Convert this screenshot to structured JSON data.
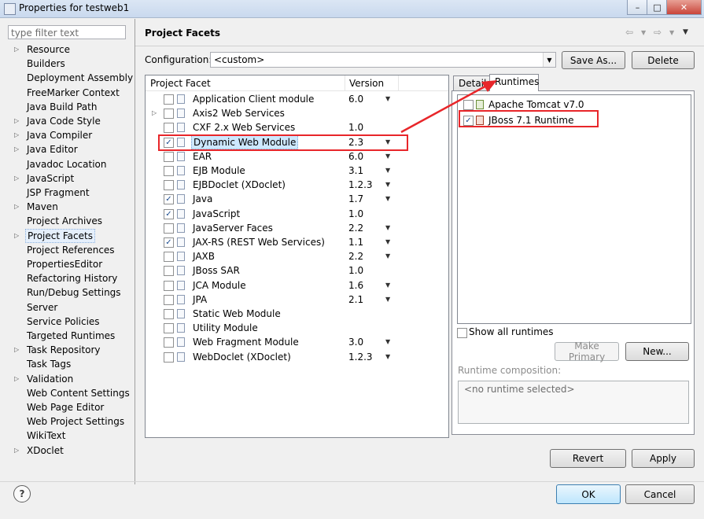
{
  "window": {
    "title": "Properties for testweb1",
    "minimize": "–",
    "maximize": "□",
    "close": "✕"
  },
  "filter": {
    "placeholder": "type filter text"
  },
  "nav": {
    "items": [
      {
        "label": "Resource",
        "expandable": true
      },
      {
        "label": "Builders",
        "expandable": false
      },
      {
        "label": "Deployment Assembly",
        "expandable": false
      },
      {
        "label": "FreeMarker Context",
        "expandable": false
      },
      {
        "label": "Java Build Path",
        "expandable": false
      },
      {
        "label": "Java Code Style",
        "expandable": true
      },
      {
        "label": "Java Compiler",
        "expandable": true
      },
      {
        "label": "Java Editor",
        "expandable": true
      },
      {
        "label": "Javadoc Location",
        "expandable": false
      },
      {
        "label": "JavaScript",
        "expandable": true
      },
      {
        "label": "JSP Fragment",
        "expandable": false
      },
      {
        "label": "Maven",
        "expandable": true
      },
      {
        "label": "Project Archives",
        "expandable": false
      },
      {
        "label": "Project Facets",
        "expandable": true,
        "selected": true
      },
      {
        "label": "Project References",
        "expandable": false
      },
      {
        "label": "PropertiesEditor",
        "expandable": false
      },
      {
        "label": "Refactoring History",
        "expandable": false
      },
      {
        "label": "Run/Debug Settings",
        "expandable": false
      },
      {
        "label": "Server",
        "expandable": false
      },
      {
        "label": "Service Policies",
        "expandable": false
      },
      {
        "label": "Targeted Runtimes",
        "expandable": false
      },
      {
        "label": "Task Repository",
        "expandable": true
      },
      {
        "label": "Task Tags",
        "expandable": false
      },
      {
        "label": "Validation",
        "expandable": true
      },
      {
        "label": "Web Content Settings",
        "expandable": false
      },
      {
        "label": "Web Page Editor",
        "expandable": false
      },
      {
        "label": "Web Project Settings",
        "expandable": false
      },
      {
        "label": "WikiText",
        "expandable": false
      },
      {
        "label": "XDoclet",
        "expandable": true
      }
    ]
  },
  "page": {
    "title": "Project Facets",
    "back_icon": "⇦",
    "forward_icon": "⇨",
    "menu_icon": "▼"
  },
  "configuration": {
    "label": "Configuration:",
    "value": "<custom>",
    "save_as": "Save As...",
    "delete": "Delete"
  },
  "facets": {
    "col_facet": "Project Facet",
    "col_version": "Version",
    "rows": [
      {
        "name": "Application Client module",
        "version": "6.0",
        "checked": false,
        "dropdown": true
      },
      {
        "name": "Axis2 Web Services",
        "version": "",
        "checked": false,
        "dropdown": false,
        "expandable": true
      },
      {
        "name": "CXF 2.x Web Services",
        "version": "1.0",
        "checked": false,
        "dropdown": false
      },
      {
        "name": "Dynamic Web Module",
        "version": "2.3",
        "checked": true,
        "dropdown": true,
        "selected": true
      },
      {
        "name": "EAR",
        "version": "6.0",
        "checked": false,
        "dropdown": true
      },
      {
        "name": "EJB Module",
        "version": "3.1",
        "checked": false,
        "dropdown": true
      },
      {
        "name": "EJBDoclet (XDoclet)",
        "version": "1.2.3",
        "checked": false,
        "dropdown": true
      },
      {
        "name": "Java",
        "version": "1.7",
        "checked": true,
        "dropdown": true
      },
      {
        "name": "JavaScript",
        "version": "1.0",
        "checked": true,
        "dropdown": false
      },
      {
        "name": "JavaServer Faces",
        "version": "2.2",
        "checked": false,
        "dropdown": true
      },
      {
        "name": "JAX-RS (REST Web Services)",
        "version": "1.1",
        "checked": true,
        "dropdown": true
      },
      {
        "name": "JAXB",
        "version": "2.2",
        "checked": false,
        "dropdown": true
      },
      {
        "name": "JBoss SAR",
        "version": "1.0",
        "checked": false,
        "dropdown": false
      },
      {
        "name": "JCA Module",
        "version": "1.6",
        "checked": false,
        "dropdown": true
      },
      {
        "name": "JPA",
        "version": "2.1",
        "checked": false,
        "dropdown": true
      },
      {
        "name": "Static Web Module",
        "version": "",
        "checked": false,
        "dropdown": false
      },
      {
        "name": "Utility Module",
        "version": "",
        "checked": false,
        "dropdown": false
      },
      {
        "name": "Web Fragment Module",
        "version": "3.0",
        "checked": false,
        "dropdown": true
      },
      {
        "name": "WebDoclet (XDoclet)",
        "version": "1.2.3",
        "checked": false,
        "dropdown": true
      }
    ]
  },
  "tabs": {
    "details": "Details",
    "runtimes": "Runtimes"
  },
  "runtimes": {
    "rows": [
      {
        "name": "Apache Tomcat v7.0",
        "checked": false
      },
      {
        "name": "JBoss 7.1 Runtime",
        "checked": true
      }
    ],
    "show_all": "Show all runtimes",
    "make_primary": "Make Primary",
    "new": "New...",
    "composition_label": "Runtime composition:",
    "composition_value": "<no runtime selected>"
  },
  "footer": {
    "revert": "Revert",
    "apply": "Apply",
    "ok": "OK",
    "cancel": "Cancel",
    "help": "?"
  },
  "colors": {
    "annotation_red": "#e8262a",
    "selection_blue": "#cde8ff"
  }
}
